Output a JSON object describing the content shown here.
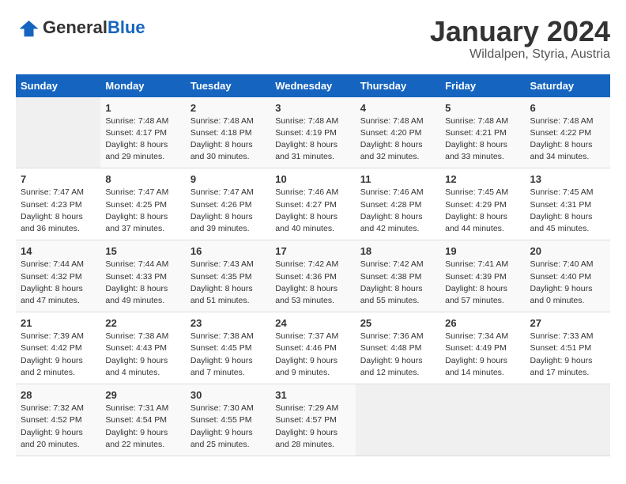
{
  "logo": {
    "general": "General",
    "blue": "Blue"
  },
  "title": "January 2024",
  "subtitle": "Wildalpen, Styria, Austria",
  "days_of_week": [
    "Sunday",
    "Monday",
    "Tuesday",
    "Wednesday",
    "Thursday",
    "Friday",
    "Saturday"
  ],
  "weeks": [
    [
      {
        "day": "",
        "sunrise": "",
        "sunset": "",
        "daylight": "",
        "empty": true
      },
      {
        "day": "1",
        "sunrise": "Sunrise: 7:48 AM",
        "sunset": "Sunset: 4:17 PM",
        "daylight": "Daylight: 8 hours and 29 minutes."
      },
      {
        "day": "2",
        "sunrise": "Sunrise: 7:48 AM",
        "sunset": "Sunset: 4:18 PM",
        "daylight": "Daylight: 8 hours and 30 minutes."
      },
      {
        "day": "3",
        "sunrise": "Sunrise: 7:48 AM",
        "sunset": "Sunset: 4:19 PM",
        "daylight": "Daylight: 8 hours and 31 minutes."
      },
      {
        "day": "4",
        "sunrise": "Sunrise: 7:48 AM",
        "sunset": "Sunset: 4:20 PM",
        "daylight": "Daylight: 8 hours and 32 minutes."
      },
      {
        "day": "5",
        "sunrise": "Sunrise: 7:48 AM",
        "sunset": "Sunset: 4:21 PM",
        "daylight": "Daylight: 8 hours and 33 minutes."
      },
      {
        "day": "6",
        "sunrise": "Sunrise: 7:48 AM",
        "sunset": "Sunset: 4:22 PM",
        "daylight": "Daylight: 8 hours and 34 minutes."
      }
    ],
    [
      {
        "day": "7",
        "sunrise": "Sunrise: 7:47 AM",
        "sunset": "Sunset: 4:23 PM",
        "daylight": "Daylight: 8 hours and 36 minutes."
      },
      {
        "day": "8",
        "sunrise": "Sunrise: 7:47 AM",
        "sunset": "Sunset: 4:25 PM",
        "daylight": "Daylight: 8 hours and 37 minutes."
      },
      {
        "day": "9",
        "sunrise": "Sunrise: 7:47 AM",
        "sunset": "Sunset: 4:26 PM",
        "daylight": "Daylight: 8 hours and 39 minutes."
      },
      {
        "day": "10",
        "sunrise": "Sunrise: 7:46 AM",
        "sunset": "Sunset: 4:27 PM",
        "daylight": "Daylight: 8 hours and 40 minutes."
      },
      {
        "day": "11",
        "sunrise": "Sunrise: 7:46 AM",
        "sunset": "Sunset: 4:28 PM",
        "daylight": "Daylight: 8 hours and 42 minutes."
      },
      {
        "day": "12",
        "sunrise": "Sunrise: 7:45 AM",
        "sunset": "Sunset: 4:29 PM",
        "daylight": "Daylight: 8 hours and 44 minutes."
      },
      {
        "day": "13",
        "sunrise": "Sunrise: 7:45 AM",
        "sunset": "Sunset: 4:31 PM",
        "daylight": "Daylight: 8 hours and 45 minutes."
      }
    ],
    [
      {
        "day": "14",
        "sunrise": "Sunrise: 7:44 AM",
        "sunset": "Sunset: 4:32 PM",
        "daylight": "Daylight: 8 hours and 47 minutes."
      },
      {
        "day": "15",
        "sunrise": "Sunrise: 7:44 AM",
        "sunset": "Sunset: 4:33 PM",
        "daylight": "Daylight: 8 hours and 49 minutes."
      },
      {
        "day": "16",
        "sunrise": "Sunrise: 7:43 AM",
        "sunset": "Sunset: 4:35 PM",
        "daylight": "Daylight: 8 hours and 51 minutes."
      },
      {
        "day": "17",
        "sunrise": "Sunrise: 7:42 AM",
        "sunset": "Sunset: 4:36 PM",
        "daylight": "Daylight: 8 hours and 53 minutes."
      },
      {
        "day": "18",
        "sunrise": "Sunrise: 7:42 AM",
        "sunset": "Sunset: 4:38 PM",
        "daylight": "Daylight: 8 hours and 55 minutes."
      },
      {
        "day": "19",
        "sunrise": "Sunrise: 7:41 AM",
        "sunset": "Sunset: 4:39 PM",
        "daylight": "Daylight: 8 hours and 57 minutes."
      },
      {
        "day": "20",
        "sunrise": "Sunrise: 7:40 AM",
        "sunset": "Sunset: 4:40 PM",
        "daylight": "Daylight: 9 hours and 0 minutes."
      }
    ],
    [
      {
        "day": "21",
        "sunrise": "Sunrise: 7:39 AM",
        "sunset": "Sunset: 4:42 PM",
        "daylight": "Daylight: 9 hours and 2 minutes."
      },
      {
        "day": "22",
        "sunrise": "Sunrise: 7:38 AM",
        "sunset": "Sunset: 4:43 PM",
        "daylight": "Daylight: 9 hours and 4 minutes."
      },
      {
        "day": "23",
        "sunrise": "Sunrise: 7:38 AM",
        "sunset": "Sunset: 4:45 PM",
        "daylight": "Daylight: 9 hours and 7 minutes."
      },
      {
        "day": "24",
        "sunrise": "Sunrise: 7:37 AM",
        "sunset": "Sunset: 4:46 PM",
        "daylight": "Daylight: 9 hours and 9 minutes."
      },
      {
        "day": "25",
        "sunrise": "Sunrise: 7:36 AM",
        "sunset": "Sunset: 4:48 PM",
        "daylight": "Daylight: 9 hours and 12 minutes."
      },
      {
        "day": "26",
        "sunrise": "Sunrise: 7:34 AM",
        "sunset": "Sunset: 4:49 PM",
        "daylight": "Daylight: 9 hours and 14 minutes."
      },
      {
        "day": "27",
        "sunrise": "Sunrise: 7:33 AM",
        "sunset": "Sunset: 4:51 PM",
        "daylight": "Daylight: 9 hours and 17 minutes."
      }
    ],
    [
      {
        "day": "28",
        "sunrise": "Sunrise: 7:32 AM",
        "sunset": "Sunset: 4:52 PM",
        "daylight": "Daylight: 9 hours and 20 minutes."
      },
      {
        "day": "29",
        "sunrise": "Sunrise: 7:31 AM",
        "sunset": "Sunset: 4:54 PM",
        "daylight": "Daylight: 9 hours and 22 minutes."
      },
      {
        "day": "30",
        "sunrise": "Sunrise: 7:30 AM",
        "sunset": "Sunset: 4:55 PM",
        "daylight": "Daylight: 9 hours and 25 minutes."
      },
      {
        "day": "31",
        "sunrise": "Sunrise: 7:29 AM",
        "sunset": "Sunset: 4:57 PM",
        "daylight": "Daylight: 9 hours and 28 minutes."
      },
      {
        "day": "",
        "sunrise": "",
        "sunset": "",
        "daylight": "",
        "empty": true
      },
      {
        "day": "",
        "sunrise": "",
        "sunset": "",
        "daylight": "",
        "empty": true
      },
      {
        "day": "",
        "sunrise": "",
        "sunset": "",
        "daylight": "",
        "empty": true
      }
    ]
  ]
}
